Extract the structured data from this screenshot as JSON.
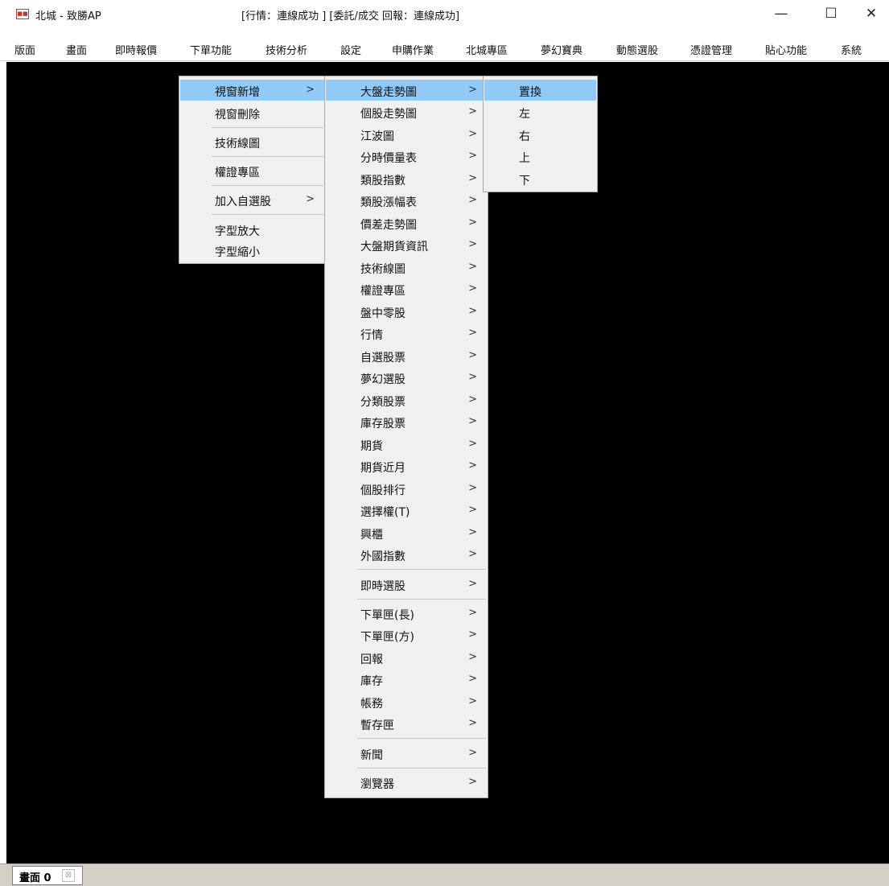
{
  "window": {
    "title": "北城 - 致勝AP",
    "status": "[行情：連線成功 ] [委託/成交 回報：連線成功]",
    "controls": {
      "minimize": "—",
      "maximize": "☐",
      "close": "✕"
    }
  },
  "menubar": {
    "items": [
      "版面",
      "畫面",
      "即時報價",
      "下單功能",
      "技術分析",
      "設定",
      "申購作業",
      "北城專區",
      "夢幻寶典",
      "動態選股",
      "憑證管理",
      "貼心功能",
      "系統"
    ]
  },
  "context_menu": {
    "items": [
      {
        "label": "視窗新增",
        "has_submenu": true,
        "highlighted": true
      },
      {
        "label": "視窗刪除",
        "has_submenu": false
      },
      {
        "label": "技術線圖",
        "has_submenu": false
      },
      {
        "label": "權證專區",
        "has_submenu": false
      },
      {
        "label": "加入自選股",
        "has_submenu": true
      },
      {
        "label": "字型放大",
        "has_submenu": false
      },
      {
        "label": "字型縮小",
        "has_submenu": false
      }
    ]
  },
  "submenu": {
    "items": [
      {
        "label": "大盤走勢圖",
        "highlighted": true
      },
      {
        "label": "個股走勢圖"
      },
      {
        "label": "江波圖"
      },
      {
        "label": "分時價量表"
      },
      {
        "label": "類股指數"
      },
      {
        "label": "類股漲幅表"
      },
      {
        "label": "價差走勢圖"
      },
      {
        "label": "大盤期貨資訊"
      },
      {
        "label": "技術線圖"
      },
      {
        "label": "權證專區"
      },
      {
        "label": "盤中零股"
      },
      {
        "label": "行情"
      },
      {
        "label": "自選股票"
      },
      {
        "label": "夢幻選股"
      },
      {
        "label": "分類股票"
      },
      {
        "label": "庫存股票"
      },
      {
        "label": "期貨"
      },
      {
        "label": "期貨近月"
      },
      {
        "label": "個股排行"
      },
      {
        "label": "選擇權(T)"
      },
      {
        "label": "興櫃"
      },
      {
        "label": "外國指數"
      },
      {
        "label": "即時選股"
      },
      {
        "label": "下單匣(長)"
      },
      {
        "label": "下單匣(方)"
      },
      {
        "label": "回報"
      },
      {
        "label": "庫存"
      },
      {
        "label": "帳務"
      },
      {
        "label": "暫存匣"
      },
      {
        "label": "新聞"
      },
      {
        "label": "瀏覽器"
      }
    ]
  },
  "position_menu": {
    "items": [
      {
        "label": "置換",
        "highlighted": true
      },
      {
        "label": "左"
      },
      {
        "label": "右"
      },
      {
        "label": "上"
      },
      {
        "label": "下"
      }
    ]
  },
  "bottom_tabs": [
    {
      "label": "畫面 0"
    }
  ],
  "colors": {
    "workspace": "#000000",
    "menu_highlight": "#91c9f7",
    "menu_bg": "#f0f0f0"
  },
  "icons": {
    "app": "app-logo-icon",
    "submenu": "chevron-right-icon",
    "tab_close": "close-icon"
  }
}
